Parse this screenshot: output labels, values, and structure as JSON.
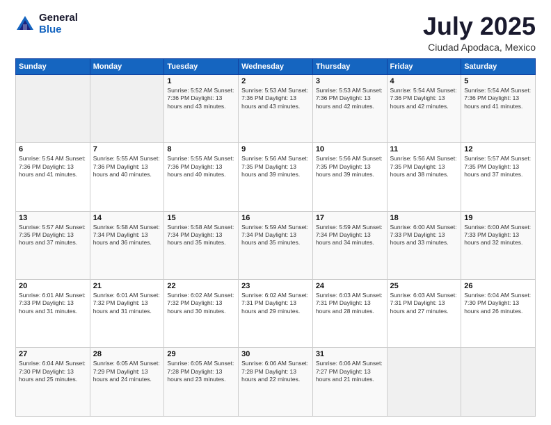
{
  "logo": {
    "general": "General",
    "blue": "Blue"
  },
  "title": "July 2025",
  "location": "Ciudad Apodaca, Mexico",
  "days_header": [
    "Sunday",
    "Monday",
    "Tuesday",
    "Wednesday",
    "Thursday",
    "Friday",
    "Saturday"
  ],
  "weeks": [
    [
      {
        "num": "",
        "info": ""
      },
      {
        "num": "",
        "info": ""
      },
      {
        "num": "1",
        "info": "Sunrise: 5:52 AM\nSunset: 7:36 PM\nDaylight: 13 hours and 43 minutes."
      },
      {
        "num": "2",
        "info": "Sunrise: 5:53 AM\nSunset: 7:36 PM\nDaylight: 13 hours and 43 minutes."
      },
      {
        "num": "3",
        "info": "Sunrise: 5:53 AM\nSunset: 7:36 PM\nDaylight: 13 hours and 42 minutes."
      },
      {
        "num": "4",
        "info": "Sunrise: 5:54 AM\nSunset: 7:36 PM\nDaylight: 13 hours and 42 minutes."
      },
      {
        "num": "5",
        "info": "Sunrise: 5:54 AM\nSunset: 7:36 PM\nDaylight: 13 hours and 41 minutes."
      }
    ],
    [
      {
        "num": "6",
        "info": "Sunrise: 5:54 AM\nSunset: 7:36 PM\nDaylight: 13 hours and 41 minutes."
      },
      {
        "num": "7",
        "info": "Sunrise: 5:55 AM\nSunset: 7:36 PM\nDaylight: 13 hours and 40 minutes."
      },
      {
        "num": "8",
        "info": "Sunrise: 5:55 AM\nSunset: 7:36 PM\nDaylight: 13 hours and 40 minutes."
      },
      {
        "num": "9",
        "info": "Sunrise: 5:56 AM\nSunset: 7:35 PM\nDaylight: 13 hours and 39 minutes."
      },
      {
        "num": "10",
        "info": "Sunrise: 5:56 AM\nSunset: 7:35 PM\nDaylight: 13 hours and 39 minutes."
      },
      {
        "num": "11",
        "info": "Sunrise: 5:56 AM\nSunset: 7:35 PM\nDaylight: 13 hours and 38 minutes."
      },
      {
        "num": "12",
        "info": "Sunrise: 5:57 AM\nSunset: 7:35 PM\nDaylight: 13 hours and 37 minutes."
      }
    ],
    [
      {
        "num": "13",
        "info": "Sunrise: 5:57 AM\nSunset: 7:35 PM\nDaylight: 13 hours and 37 minutes."
      },
      {
        "num": "14",
        "info": "Sunrise: 5:58 AM\nSunset: 7:34 PM\nDaylight: 13 hours and 36 minutes."
      },
      {
        "num": "15",
        "info": "Sunrise: 5:58 AM\nSunset: 7:34 PM\nDaylight: 13 hours and 35 minutes."
      },
      {
        "num": "16",
        "info": "Sunrise: 5:59 AM\nSunset: 7:34 PM\nDaylight: 13 hours and 35 minutes."
      },
      {
        "num": "17",
        "info": "Sunrise: 5:59 AM\nSunset: 7:34 PM\nDaylight: 13 hours and 34 minutes."
      },
      {
        "num": "18",
        "info": "Sunrise: 6:00 AM\nSunset: 7:33 PM\nDaylight: 13 hours and 33 minutes."
      },
      {
        "num": "19",
        "info": "Sunrise: 6:00 AM\nSunset: 7:33 PM\nDaylight: 13 hours and 32 minutes."
      }
    ],
    [
      {
        "num": "20",
        "info": "Sunrise: 6:01 AM\nSunset: 7:33 PM\nDaylight: 13 hours and 31 minutes."
      },
      {
        "num": "21",
        "info": "Sunrise: 6:01 AM\nSunset: 7:32 PM\nDaylight: 13 hours and 31 minutes."
      },
      {
        "num": "22",
        "info": "Sunrise: 6:02 AM\nSunset: 7:32 PM\nDaylight: 13 hours and 30 minutes."
      },
      {
        "num": "23",
        "info": "Sunrise: 6:02 AM\nSunset: 7:31 PM\nDaylight: 13 hours and 29 minutes."
      },
      {
        "num": "24",
        "info": "Sunrise: 6:03 AM\nSunset: 7:31 PM\nDaylight: 13 hours and 28 minutes."
      },
      {
        "num": "25",
        "info": "Sunrise: 6:03 AM\nSunset: 7:31 PM\nDaylight: 13 hours and 27 minutes."
      },
      {
        "num": "26",
        "info": "Sunrise: 6:04 AM\nSunset: 7:30 PM\nDaylight: 13 hours and 26 minutes."
      }
    ],
    [
      {
        "num": "27",
        "info": "Sunrise: 6:04 AM\nSunset: 7:30 PM\nDaylight: 13 hours and 25 minutes."
      },
      {
        "num": "28",
        "info": "Sunrise: 6:05 AM\nSunset: 7:29 PM\nDaylight: 13 hours and 24 minutes."
      },
      {
        "num": "29",
        "info": "Sunrise: 6:05 AM\nSunset: 7:28 PM\nDaylight: 13 hours and 23 minutes."
      },
      {
        "num": "30",
        "info": "Sunrise: 6:06 AM\nSunset: 7:28 PM\nDaylight: 13 hours and 22 minutes."
      },
      {
        "num": "31",
        "info": "Sunrise: 6:06 AM\nSunset: 7:27 PM\nDaylight: 13 hours and 21 minutes."
      },
      {
        "num": "",
        "info": ""
      },
      {
        "num": "",
        "info": ""
      }
    ]
  ]
}
